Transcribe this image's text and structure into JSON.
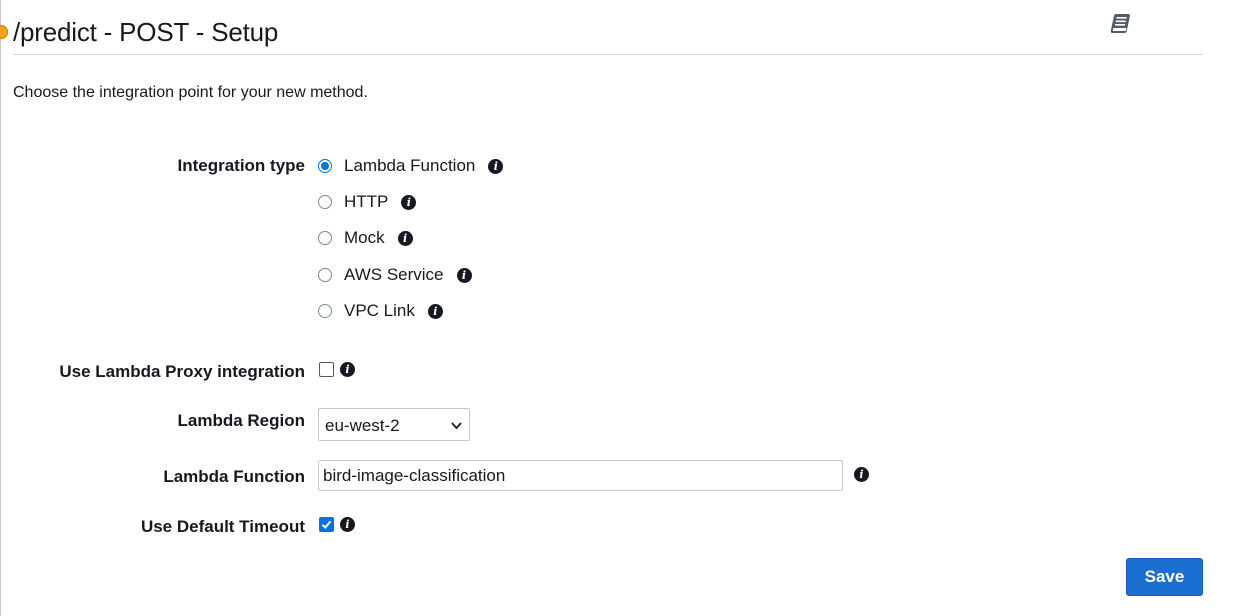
{
  "page": {
    "title": "/predict - POST - Setup",
    "intro": "Choose the integration point for your new method."
  },
  "form": {
    "integration_type_label": "Integration type",
    "integration_options": [
      {
        "label": "Lambda Function",
        "selected": true
      },
      {
        "label": "HTTP",
        "selected": false
      },
      {
        "label": "Mock",
        "selected": false
      },
      {
        "label": "AWS Service",
        "selected": false
      },
      {
        "label": "VPC Link",
        "selected": false
      }
    ],
    "proxy_label": "Use Lambda Proxy integration",
    "proxy_checked": false,
    "region_label": "Lambda Region",
    "region_value": "eu-west-2",
    "function_label": "Lambda Function",
    "function_value": "bird-image-classification",
    "timeout_label": "Use Default Timeout",
    "timeout_checked": true
  },
  "actions": {
    "save_label": "Save"
  },
  "icons": {
    "info": "info-icon",
    "docs": "book-icon",
    "chevron": "chevron-down-icon"
  },
  "colors": {
    "accent": "#0073e6",
    "save_button": "#1a6fd1",
    "marker": "#f2a31b"
  }
}
